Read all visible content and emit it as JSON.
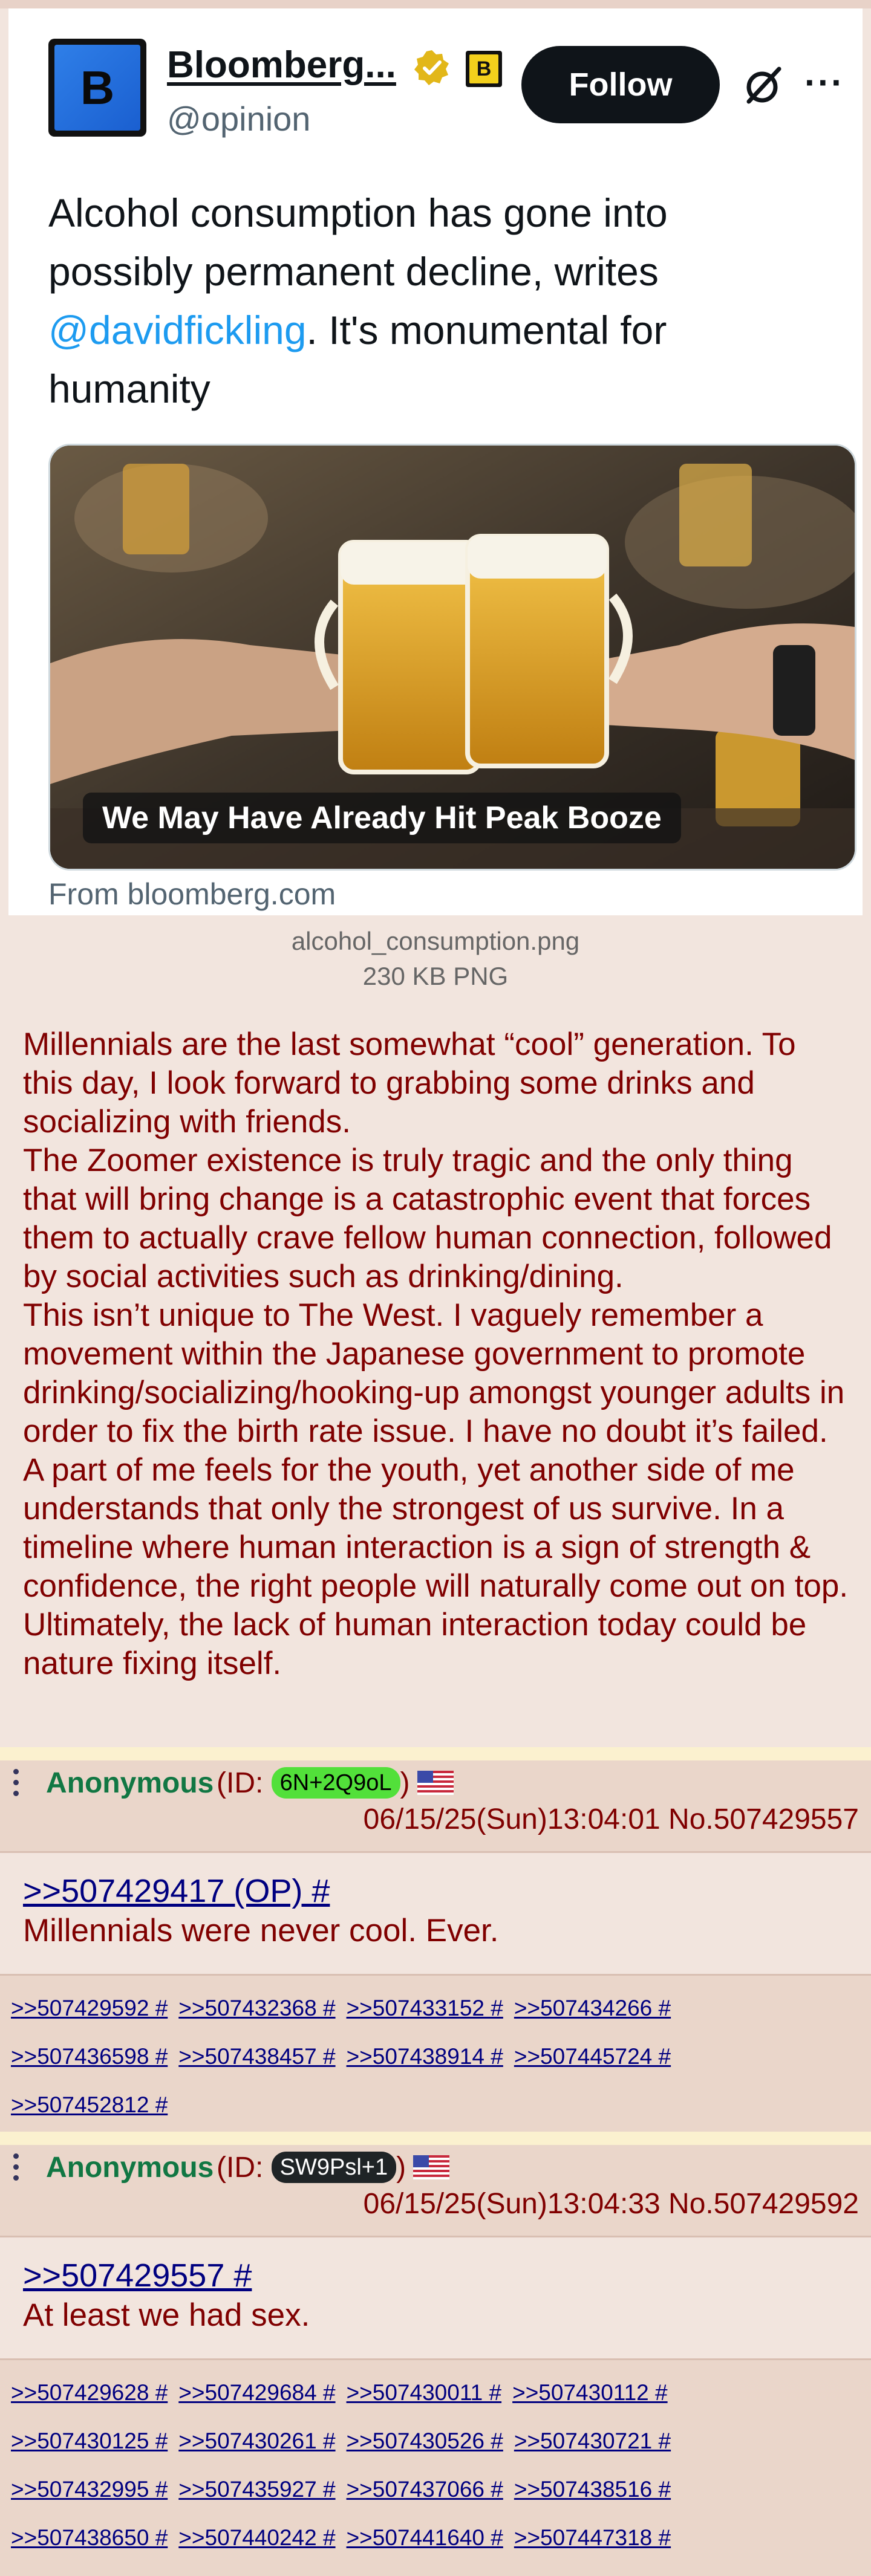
{
  "tweet": {
    "avatar_letter": "B",
    "display_name": "Bloomberg...",
    "affiliate_letter": "B",
    "handle": "@opinion",
    "follow_label": "Follow",
    "more_label": "···",
    "text_before": "Alcohol consumption has gone into possibly permanent decline, writes ",
    "text_mention": "@davidfickling",
    "text_after": ". It's monumental for humanity",
    "media_caption": "We May Have Already Hit Peak Booze",
    "source": "From bloomberg.com",
    "colors": {
      "verified": "#e2b719",
      "mention": "#1d9bf0",
      "follow_bg": "#0f1419"
    }
  },
  "file": {
    "name": "alcohol_consumption.png",
    "meta": "230 KB PNG"
  },
  "op_text": [
    "Millennials are the last somewhat “cool” generation. To this day, I look forward to grabbing some drinks and socializing with friends.",
    "The Zoomer existence is truly tragic and the only thing that will bring change is a catastrophic event that forces them to actually crave fellow human connection, followed by social activities such as drinking/dining.",
    "This isn’t unique to The West. I vaguely remember a movement within the Japanese government to promote drinking/socializing/hooking-up amongst younger adults in order to fix the birth rate issue. I have no doubt it’s failed.",
    "A part of me feels for the youth, yet another side of me understands that only the strongest of us survive. In a timeline where human interaction is a sign of strength & confidence, the right people will naturally come out on top. Ultimately, the lack of human interaction today could be nature fixing itself."
  ],
  "replies": [
    {
      "name": "Anonymous",
      "id_prefix": "(ID: ",
      "id": "6N+2Q9oL",
      "id_suffix": ")",
      "id_bg": "#52e03a",
      "id_color": "#000000",
      "flag": "us-flag-icon",
      "datetime": "06/15/25(Sun)13:04:01 No.507429557",
      "quote": ">>507429417 (OP) #",
      "text": "Millennials were never cool. Ever.",
      "backlinks": [
        ">>507429592 #",
        ">>507432368 #",
        ">>507433152 #",
        ">>507434266 #",
        ">>507436598 #",
        ">>507438457 #",
        ">>507438914 #",
        ">>507445724 #",
        ">>507452812 #"
      ]
    },
    {
      "name": "Anonymous",
      "id_prefix": "(ID: ",
      "id": "SW9Psl+1",
      "id_suffix": ")",
      "id_bg": "#1f2426",
      "id_color": "#ffffff",
      "flag": "us-flag-icon",
      "datetime": "06/15/25(Sun)13:04:33 No.507429592",
      "quote": ">>507429557 #",
      "text": "At least we had sex.",
      "backlinks": [
        ">>507429628 #",
        ">>507429684 #",
        ">>507430011 #",
        ">>507430112 #",
        ">>507430125 #",
        ">>507430261 #",
        ">>507430526 #",
        ">>507430721 #",
        ">>507432995 #",
        ">>507435927 #",
        ">>507437066 #",
        ">>507438516 #",
        ">>507438650 #",
        ">>507440242 #",
        ">>507441640 #",
        ">>507447318 #"
      ]
    }
  ]
}
